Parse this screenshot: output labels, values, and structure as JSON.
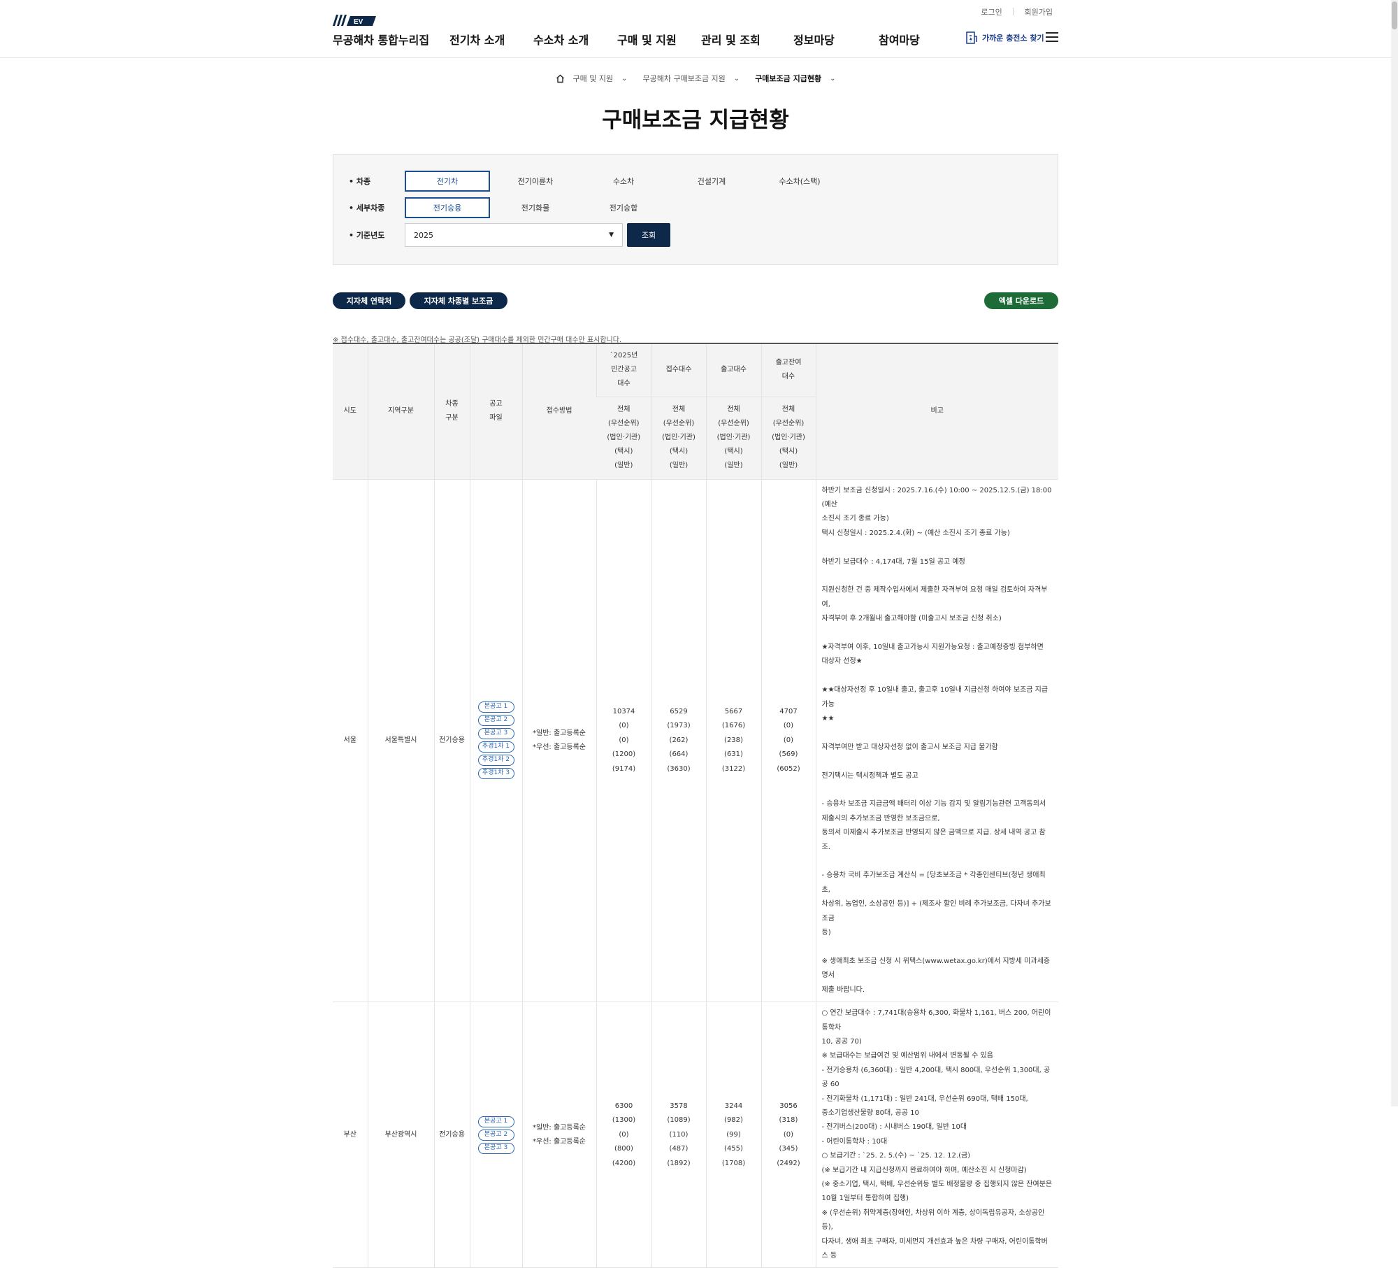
{
  "header": {
    "util_links": [
      "로그인",
      "회원가입"
    ],
    "logo_badge": "EV",
    "site_name": "무공해차 통합누리집",
    "nav": [
      "전기차 소개",
      "수소차 소개",
      "구매 및 지원",
      "관리 및 조회",
      "정보마당",
      "참여마당"
    ],
    "charger_link": "가까운 충전소 찾기"
  },
  "breadcrumb": [
    "구매 및 지원",
    "무공해차 구매보조금 지원",
    "구매보조금 지급현황"
  ],
  "page_title": "구매보조금 지급현황",
  "search": {
    "vehicle_label": "차종",
    "vehicle_options": [
      "전기차",
      "전기이륜차",
      "수소차",
      "건설기계",
      "수소차(스택)"
    ],
    "sub_label": "세부차종",
    "sub_options": [
      "전기승용",
      "전기화물",
      "전기승합"
    ],
    "year_label": "기준년도",
    "year_value": "2025",
    "search_button": "조회"
  },
  "actions": {
    "contact": "지자체 연락처",
    "subsidy": "지자체 차종별 보조금",
    "excel": "엑셀 다운로드"
  },
  "note": "※ 접수대수, 출고대수, 출고잔여대수는 공공(조달) 구매대수를 제외한 민간구매 대수만 표시합니다.",
  "table": {
    "headers": {
      "sido": "시도",
      "region": "지역구분",
      "type": [
        "차종",
        "구분"
      ],
      "file": [
        "공고",
        "파일"
      ],
      "method": "접수방법",
      "notice_count": [
        "`2025년",
        "민간공고",
        "대수"
      ],
      "received": "접수대수",
      "released": "출고대수",
      "remaining": [
        "출고잔여",
        "대수"
      ],
      "sub": [
        "전체",
        "(우선순위)",
        "(법인·기관)",
        "(택시)",
        "(일반)"
      ],
      "remark": "비고"
    },
    "rows": [
      {
        "sido": "서울",
        "region": "서울특별시",
        "type": "전기승용",
        "files": [
          "본공고 1",
          "본공고 2",
          "본공고 3",
          "추경1차 1",
          "추경1차 2",
          "추경1차 3"
        ],
        "method": [
          "*일반: 출고등록순",
          "*우선: 출고등록순"
        ],
        "notice": [
          "10374",
          "(0)",
          "(0)",
          "(1200)",
          "(9174)"
        ],
        "received": [
          "6529",
          "(1973)",
          "(262)",
          "(664)",
          "(3630)"
        ],
        "released": [
          "5667",
          "(1676)",
          "(238)",
          "(631)",
          "(3122)"
        ],
        "remaining": [
          "4707",
          "(0)",
          "(0)",
          "(569)",
          "(6052)"
        ],
        "remark": "하반기 보조금 신청일시 : 2025.7.16.(수) 10:00 ~ 2025.12.5.(금) 18:00 (예산\n소진시 조기 종료 가능)\n택시 신청일시 : 2025.2.4.(화) ~ (예산 소진시 조기 종료 가능)\n\n하반기 보급대수 : 4,174대, 7월 15일 공고 예정\n\n지원신청한 건 중 제작수입사에서 제출한 자격부여 요청 매일 검토하여 자격부여,\n자격부여 후 2개월내 출고해야함 (미출고시 보조금 신청 취소)\n\n★자격부여 이후, 10일내 출고가능시 지원가능요청 : 출고예정증빙 첨부하면\n대상자 선정★\n\n★★대상자선정 후 10일내 출고, 출고후 10일내 지급신청 하여야 보조금 지급 가능\n★★\n\n자격부여만 받고 대상자선정 없이 출고시 보조금 지급 불가함\n\n전기택시는 택시정책과 별도 공고\n\n- 승용차 보조금 지급금액 배터리 이상 기능 감지 및 알림기능관련 고객동의서\n제출시의 추가보조금 반영한 보조금으로,\n동의서 미제출시 추가보조금 반영되지 않은 금액으로 지급. 상세 내역 공고 참조.\n\n- 승용차 국비 추가보조금 계산식 = [당초보조금 * 각종인센티브(청년 생애최초,\n차상위, 농업인, 소상공인 등)] + (제조사 할인 비례 추가보조금, 다자녀 추가보조금\n등)\n\n※ 생애최초 보조금 신청 시 위택스(www.wetax.go.kr)에서 지방세 미과세증명서\n제출 바랍니다."
      },
      {
        "sido": "부산",
        "region": "부산광역시",
        "type": "전기승용",
        "files": [
          "본공고 1",
          "본공고 2",
          "본공고 3"
        ],
        "method": [
          "*일반: 출고등록순",
          "*우선: 출고등록순"
        ],
        "notice": [
          "6300",
          "(1300)",
          "(0)",
          "(800)",
          "(4200)"
        ],
        "received": [
          "3578",
          "(1089)",
          "(110)",
          "(487)",
          "(1892)"
        ],
        "released": [
          "3244",
          "(982)",
          "(99)",
          "(455)",
          "(1708)"
        ],
        "remaining": [
          "3056",
          "(318)",
          "(0)",
          "(345)",
          "(2492)"
        ],
        "remark": "○ 연간 보급대수 : 7,741대(승용차 6,300, 화물차 1,161, 버스 200, 어린이통학차\n10, 공공 70)\n※ 보급대수는 보급여건 및 예산범위 내에서 변동될 수 있음\n- 전기승용차 (6,360대) : 일반 4,200대, 택시 800대, 우선순위 1,300대, 공공 60\n- 전기화물차 (1,171대) : 일반 241대, 우선순위 690대, 택배 150대,\n중소기업생산물량 80대, 공공 10\n- 전기버스(200대) : 시내버스 190대, 일반 10대\n- 어린이통학차 : 10대\n○ 보급기간 : `25. 2. 5.(수) ~ `25. 12. 12.(금)\n(※ 보급기간 내 지급신청까지 완료하여야 하며, 예산소진 시 신청마감)\n(※ 중소기업, 택시, 택배, 우선순위등 별도 배정물량 중 집행되지 않은 잔여분은\n10월 1일부터 통합하여 집행)\n※ (우선순위) 취약계층(장애인, 차상위 이하 계층, 상이독립유공자, 소상공인 등),\n다자녀, 생애 최초 구매자, 미세먼지 개선효과 높은 차량 구매자, 어린이통학버스 등"
      }
    ]
  }
}
